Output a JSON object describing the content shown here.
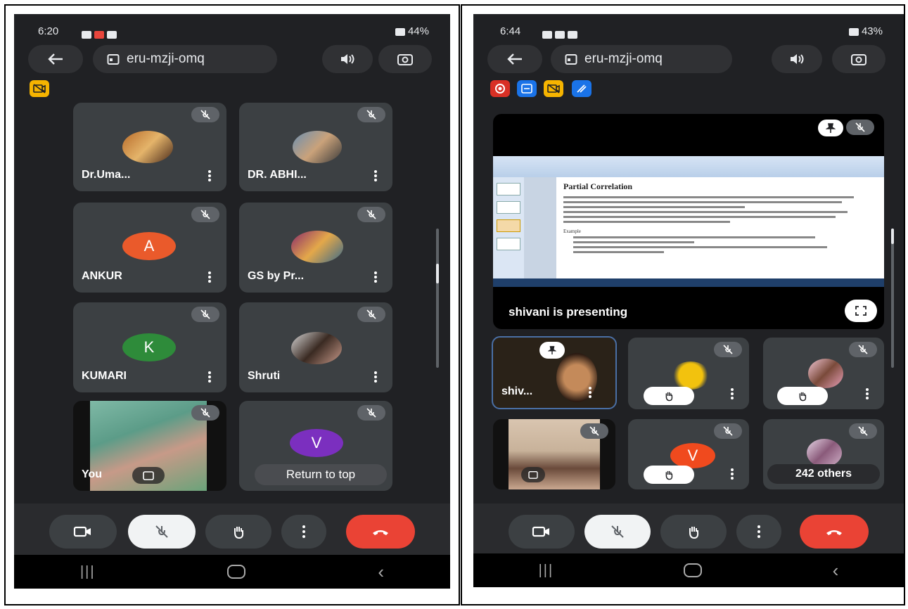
{
  "left": {
    "status": {
      "time": "6:20",
      "battery": "44%"
    },
    "meeting_code": "eru-mzji-omq",
    "tiles": [
      {
        "name": "Dr.Uma..."
      },
      {
        "name": "DR. ABHI..."
      },
      {
        "name": "ANKUR",
        "initial": "A"
      },
      {
        "name": "GS by Pr..."
      },
      {
        "name": "KUMARI",
        "initial": "K"
      },
      {
        "name": "Shruti"
      },
      {
        "name": "You"
      },
      {
        "name": "",
        "initial": "V"
      }
    ],
    "return_to_top": "Return to top"
  },
  "right": {
    "status": {
      "time": "6:44",
      "battery": "43%"
    },
    "meeting_code": "eru-mzji-omq",
    "slide": {
      "title": "Partial Correlation",
      "example_label": "Example"
    },
    "presenting_text": "shivani is presenting",
    "tiles": [
      {
        "name": "shiv..."
      },
      {
        "name": ""
      },
      {
        "name": ""
      },
      {
        "name": ""
      },
      {
        "name": "",
        "initial": "V"
      },
      {
        "name": "242 others"
      }
    ]
  },
  "colors": {
    "background": "#202124",
    "tile": "#3c4043",
    "end_call": "#ea4335",
    "avatar_a": "#ea5a2b",
    "avatar_k": "#2e8b3a",
    "avatar_v_left": "#7b2fbf",
    "avatar_v_right": "#f04a1e",
    "badge_yellow": "#f6b400",
    "badge_red": "#d93025",
    "badge_blue": "#1a73e8"
  },
  "icons": [
    "back-arrow-icon",
    "calendar-icon",
    "speaker-icon",
    "camera-flip-icon",
    "camera-off-icon",
    "mic-off-icon",
    "more-vert-icon",
    "hand-raise-icon",
    "video-icon",
    "end-call-icon",
    "pin-icon",
    "fullscreen-icon",
    "nav-recents-icon",
    "nav-home-icon",
    "nav-back-icon",
    "recording-icon",
    "captions-icon",
    "whiteboard-icon"
  ]
}
